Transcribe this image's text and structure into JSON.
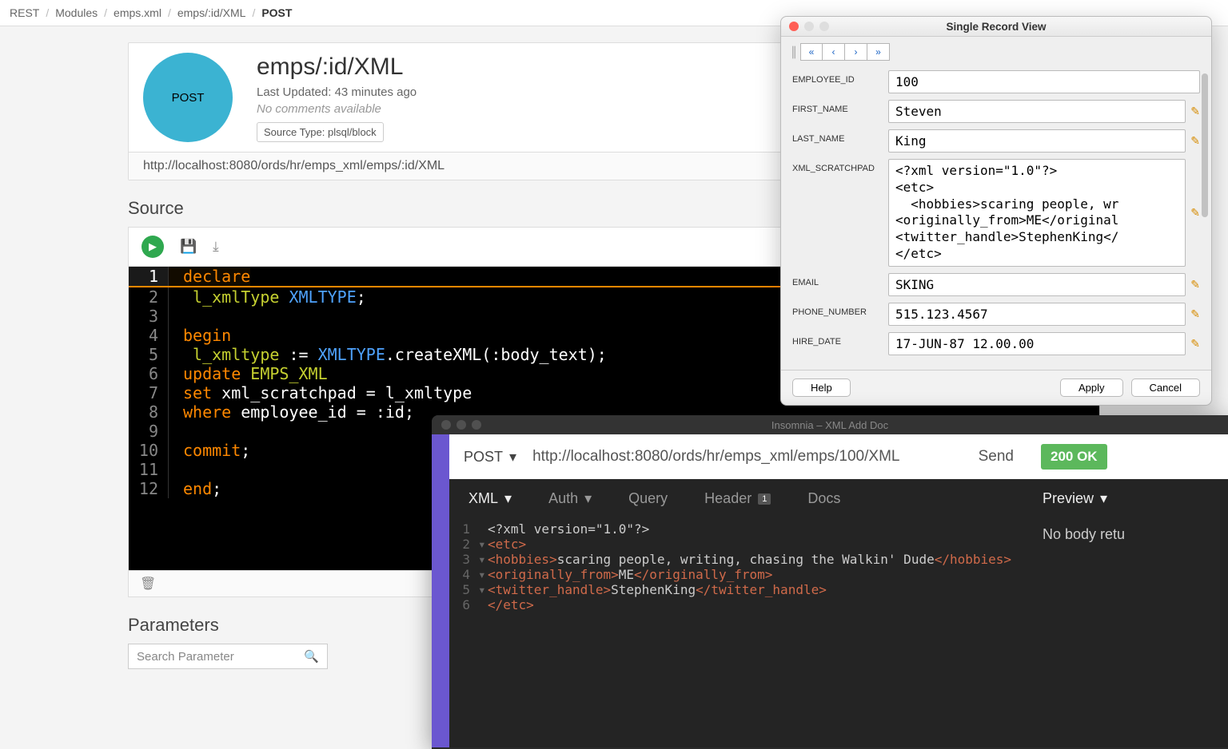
{
  "breadcrumb": [
    "REST",
    "Modules",
    "emps.xml",
    "emps/:id/XML",
    "POST"
  ],
  "header": {
    "method": "POST",
    "title": "emps/:id/XML",
    "last_updated": "Last Updated: 43 minutes ago",
    "no_comments": "No comments available",
    "source_type": "Source Type: plsql/block",
    "url": "http://localhost:8080/ords/hr/emps_xml/emps/:id/XML"
  },
  "sections": {
    "source": "Source",
    "parameters": "Parameters"
  },
  "code": {
    "l1_kw": "declare",
    "l2_id": "l_xmlType",
    "l2_type": "XMLTYPE",
    "l4_kw": "begin",
    "l5_id": "l_xmltype",
    "l5_type": "XMLTYPE",
    "l5_fn": ".createXML(:body_text);",
    "l6_kw": "update",
    "l6_tbl": "EMPS_XML",
    "l7_kw": "set",
    "l7_rest": "xml_scratchpad = l_xmltype",
    "l8_kw": "where",
    "l8_rest": "employee_id = :id;",
    "l10_kw": "commit",
    "l12_kw": "end"
  },
  "params_placeholder": "Search Parameter",
  "record": {
    "title": "Single Record View",
    "labels": {
      "employee_id": "EMPLOYEE_ID",
      "first_name": "FIRST_NAME",
      "last_name": "LAST_NAME",
      "xml": "XML_SCRATCHPAD",
      "email": "EMAIL",
      "phone": "PHONE_NUMBER",
      "hire_date": "HIRE_DATE"
    },
    "values": {
      "employee_id": "100",
      "first_name": "Steven",
      "last_name": "King",
      "xml": "<?xml version=\"1.0\"?>\n<etc>\n  <hobbies>scaring people, wr\n<originally_from>ME</original\n<twitter_handle>StephenKing</\n</etc>",
      "email": "SKING",
      "phone": "515.123.4567",
      "hire_date": "17-JUN-87 12.00.00"
    },
    "buttons": {
      "help": "Help",
      "apply": "Apply",
      "cancel": "Cancel"
    }
  },
  "insomnia": {
    "title": "Insomnia – XML Add Doc",
    "method": "POST",
    "url": "http://localhost:8080/ords/hr/emps_xml/emps/100/XML",
    "send": "Send",
    "status": "200 OK",
    "tabs": {
      "body": "XML",
      "auth": "Auth",
      "query": "Query",
      "header": "Header",
      "header_badge": "1",
      "docs": "Docs"
    },
    "resp_tab": "Preview",
    "resp_body": "No body retu",
    "xml": {
      "l1": "<?xml version=\"1.0\"?>",
      "l2_open": "<etc>",
      "l3_open": "<hobbies>",
      "l3_text": "scaring people, writing, chasing the Walkin' Dude",
      "l3_close": "</hobbies>",
      "l4_open": "<originally_from>",
      "l4_text": "ME",
      "l4_close": "</originally_from>",
      "l5_open": "<twitter_handle>",
      "l5_text": "StephenKing",
      "l5_close": "</twitter_handle>",
      "l6_close": "</etc>"
    }
  }
}
